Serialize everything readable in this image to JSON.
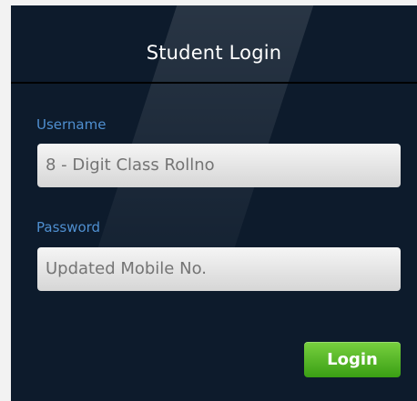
{
  "header": {
    "title": "Student Login"
  },
  "form": {
    "username_label": "Username",
    "username_placeholder": "8 - Digit Class Rollno",
    "password_label": "Password",
    "password_placeholder": "Updated Mobile No.",
    "login_label": "Login"
  },
  "colors": {
    "panel_bg": "#0d1b2c",
    "label_blue": "#4f8fd0",
    "button_green": "#47b51a"
  }
}
